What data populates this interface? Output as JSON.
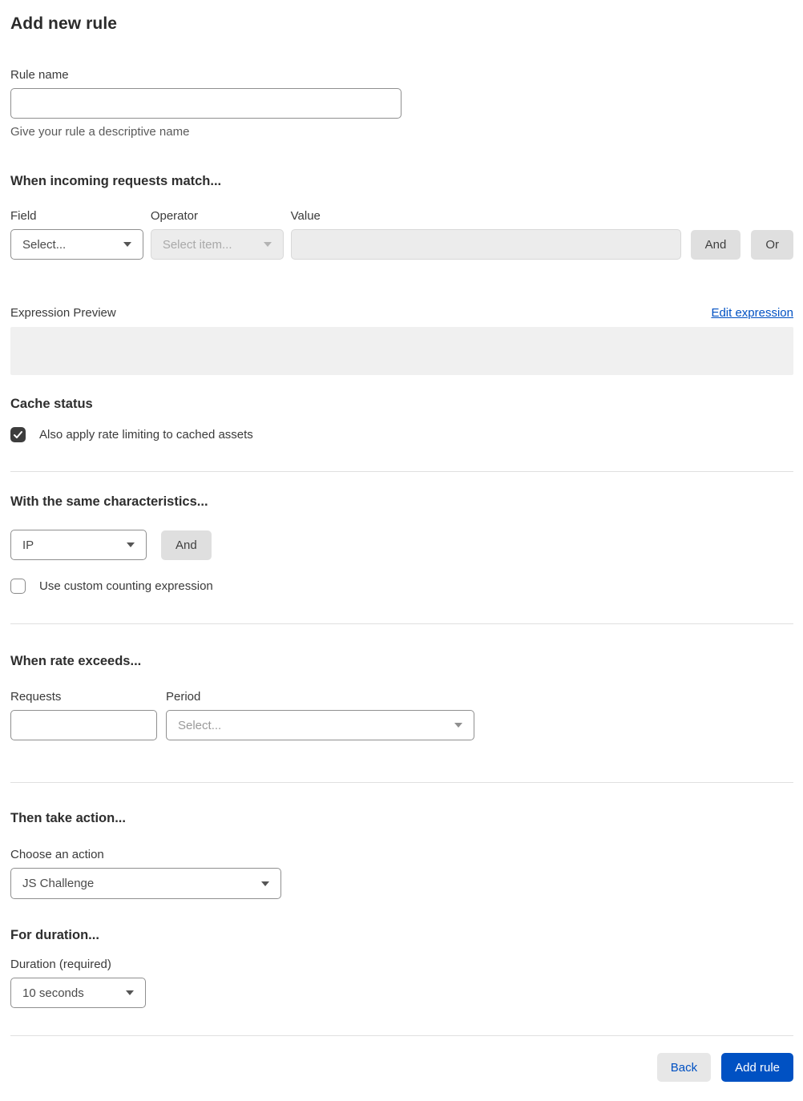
{
  "page": {
    "title": "Add new rule"
  },
  "rule_name": {
    "label": "Rule name",
    "value": "",
    "helper": "Give your rule a descriptive name"
  },
  "match": {
    "heading": "When incoming requests match...",
    "field": {
      "label": "Field",
      "selected": "Select..."
    },
    "operator": {
      "label": "Operator",
      "selected": "Select item...",
      "disabled": true
    },
    "value": {
      "label": "Value",
      "value": "",
      "disabled": true
    },
    "and_label": "And",
    "or_label": "Or"
  },
  "expression": {
    "label": "Expression Preview",
    "edit_link": "Edit expression",
    "content": ""
  },
  "cache": {
    "heading": "Cache status",
    "checkbox_label": "Also apply rate limiting to cached assets",
    "checked": true
  },
  "characteristics": {
    "heading": "With the same characteristics...",
    "selected": "IP",
    "and_label": "And",
    "checkbox_label": "Use custom counting expression",
    "checked": false
  },
  "rate": {
    "heading": "When rate exceeds...",
    "requests": {
      "label": "Requests",
      "value": ""
    },
    "period": {
      "label": "Period",
      "selected": "Select..."
    }
  },
  "action": {
    "heading": "Then take action...",
    "label": "Choose an action",
    "selected": "JS Challenge"
  },
  "duration": {
    "heading": "For duration...",
    "label": "Duration (required)",
    "selected": "10 seconds"
  },
  "footer": {
    "back_label": "Back",
    "add_label": "Add rule"
  },
  "colors": {
    "accent_blue": "#0051c3",
    "checkbox_checked": "#3d3d3d",
    "disabled_bg": "#ececec",
    "preview_bg": "#f0f0f0",
    "button_gray": "#dfdfdf"
  }
}
